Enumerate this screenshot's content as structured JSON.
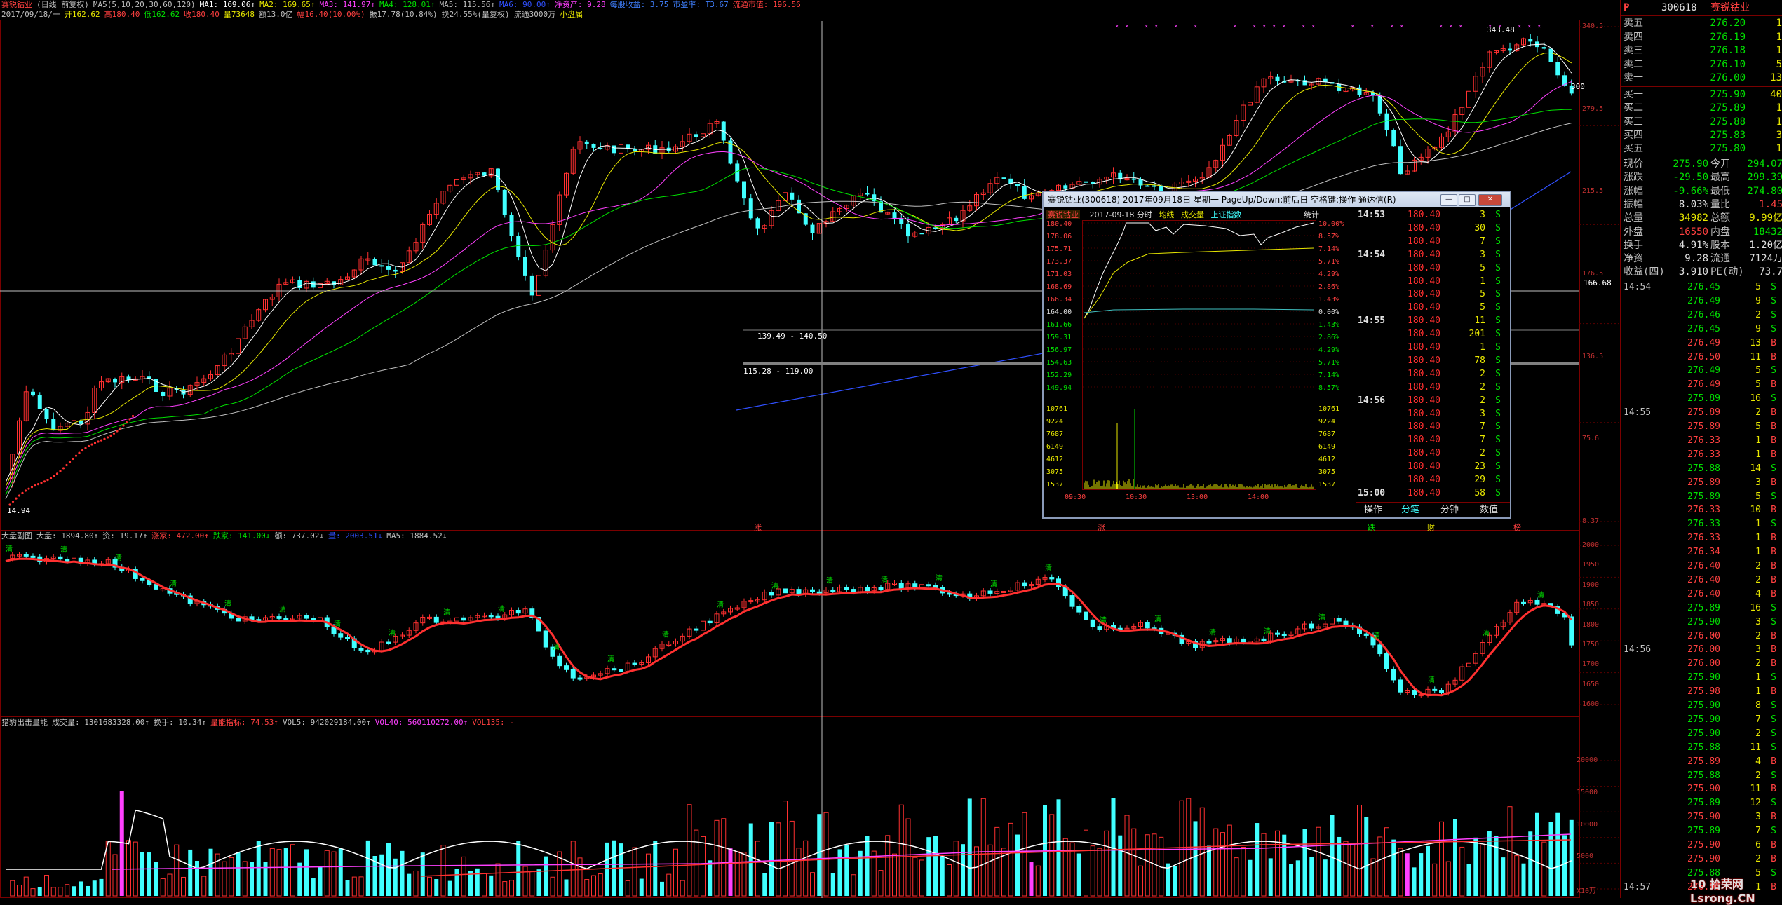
{
  "stock": {
    "name": "赛锐钴业",
    "code": "300618"
  },
  "main_header": {
    "line1": [
      {
        "text": "赛锐钴业",
        "color": "#ff4040"
      },
      {
        "text": "(日线 前复权)",
        "color": "#c0c0c0"
      },
      {
        "text": "MA5(5,10,20,30,60,120)",
        "color": "#c0c0c0"
      },
      {
        "text": "MA1: 169.06↑",
        "color": "#ffffff"
      },
      {
        "text": "MA2: 169.65↑",
        "color": "#e8e800"
      },
      {
        "text": "MA3: 141.97↑",
        "color": "#ff40ff"
      },
      {
        "text": "MA4: 128.01↑",
        "color": "#00e000"
      },
      {
        "text": "MA5: 115.56↑",
        "color": "#c0c0c0"
      },
      {
        "text": "MA6: 90.00↑",
        "color": "#3050ff"
      },
      {
        "text": "净资产: 9.28",
        "color": "#ff40ff"
      },
      {
        "text": "每股收益: 3.75",
        "color": "#4080ff"
      },
      {
        "text": "市盈率: T3.67",
        "color": "#4080ff"
      },
      {
        "text": "流通市值: 196.56",
        "color": "#ff4040"
      }
    ],
    "line2": [
      {
        "text": "2017/09/18/一",
        "color": "#c0c0c0"
      },
      {
        "text": "开162.62",
        "color": "#e8e800"
      },
      {
        "text": "高180.40",
        "color": "#ff4040"
      },
      {
        "text": "低162.62",
        "color": "#00e000"
      },
      {
        "text": "收180.40",
        "color": "#ff4040"
      },
      {
        "text": "量73648",
        "color": "#e8e800"
      },
      {
        "text": "额13.0亿",
        "color": "#c0c0c0"
      },
      {
        "text": "幅16.40(10.00%)",
        "color": "#ff4040"
      },
      {
        "text": "振17.78(10.84%)",
        "color": "#c0c0c0"
      },
      {
        "text": "换24.55%(量复权)",
        "color": "#c0c0c0"
      },
      {
        "text": "流通3000万",
        "color": "#c0c0c0"
      },
      {
        "text": "小盘属",
        "color": "#e8e800"
      }
    ]
  },
  "main_chart": {
    "annotations": [
      "343.48",
      "139.49 - 140.50",
      "115.28 - 119.00",
      "14.94",
      "166.68",
      "300"
    ],
    "right_axis": [
      "340.5",
      "279.5",
      "215.5",
      "176.5",
      "136.5",
      "75.6",
      "8.37"
    ],
    "crosshair_price": "166.68",
    "signal_labels": [
      "涨",
      "涨",
      "跌",
      "财",
      "榜"
    ]
  },
  "market_header": {
    "items": [
      {
        "text": "大盘副图",
        "color": "#c0c0c0"
      },
      {
        "text": "大盘: 1894.80↑",
        "color": "#c0c0c0"
      },
      {
        "text": "资: 19.17↑",
        "color": "#c0c0c0"
      },
      {
        "text": "涨家: 472.00↑",
        "color": "#ff4040"
      },
      {
        "text": "跌家: 141.00↓",
        "color": "#00e000"
      },
      {
        "text": "额: 737.02↓",
        "color": "#c0c0c0"
      },
      {
        "text": "量: 2003.51↓",
        "color": "#3050ff"
      },
      {
        "text": "MA5: 1884.52↓",
        "color": "#c0c0c0"
      }
    ],
    "right_axis": [
      "2000",
      "1950",
      "1900",
      "1850",
      "1800",
      "1750",
      "1700",
      "1650",
      "1600"
    ],
    "marker": "清"
  },
  "volume_header": {
    "items": [
      {
        "text": "猎豹出击量能",
        "color": "#c0c0c0"
      },
      {
        "text": "成交量: 1301683328.00↑",
        "color": "#c0c0c0"
      },
      {
        "text": "换手: 10.34↑",
        "color": "#c0c0c0"
      },
      {
        "text": "量能指标: 74.53↑",
        "color": "#ff4040"
      },
      {
        "text": "VOL5: 942029184.00↑",
        "color": "#c0c0c0"
      },
      {
        "text": "VOL40: 560110272.00↑",
        "color": "#ff40ff"
      },
      {
        "text": "VOL135: -",
        "color": "#ff4040"
      }
    ],
    "right_axis": [
      "20000",
      "15000",
      "10000",
      "5000",
      "X10万"
    ]
  },
  "popup": {
    "title": "赛锐钴业(300618)  2017年09月18日 星期一  PageUp/Down:前后日  空格键:操作  通达信(R)",
    "sub_header": [
      "赛锐钴业",
      "2017-09-18 分时",
      "均线",
      "成交量",
      "上证指数",
      "统计"
    ],
    "price_axis_left": [
      "180.40",
      "178.06",
      "175.71",
      "173.37",
      "171.03",
      "168.69",
      "166.34",
      "164.00",
      "161.66",
      "159.31",
      "156.97",
      "154.63",
      "152.29",
      "149.94"
    ],
    "pct_axis_right": [
      "10.00%",
      "8.57%",
      "7.14%",
      "5.71%",
      "4.29%",
      "2.86%",
      "1.43%",
      "0.00%",
      "1.43%",
      "2.86%",
      "4.29%",
      "5.71%",
      "7.14%",
      "8.57%"
    ],
    "vol_axis_left": [
      "10761",
      "9224",
      "7687",
      "6149",
      "4612",
      "3075",
      "1537"
    ],
    "vol_axis_right": [
      "10761",
      "9224",
      "7687",
      "6149",
      "4612",
      "3075",
      "1537"
    ],
    "time_axis": [
      "09:30",
      "10:30",
      "13:00",
      "14:00"
    ],
    "ticks": [
      {
        "time": "14:53",
        "price": "180.40",
        "vol": "3",
        "side": "S"
      },
      {
        "time": "",
        "price": "180.40",
        "vol": "30",
        "side": "S"
      },
      {
        "time": "",
        "price": "180.40",
        "vol": "7",
        "side": "S"
      },
      {
        "time": "14:54",
        "price": "180.40",
        "vol": "3",
        "side": "S"
      },
      {
        "time": "",
        "price": "180.40",
        "vol": "5",
        "side": "S"
      },
      {
        "time": "",
        "price": "180.40",
        "vol": "1",
        "side": "S"
      },
      {
        "time": "",
        "price": "180.40",
        "vol": "5",
        "side": "S"
      },
      {
        "time": "",
        "price": "180.40",
        "vol": "5",
        "side": "S"
      },
      {
        "time": "14:55",
        "price": "180.40",
        "vol": "11",
        "side": "S"
      },
      {
        "time": "",
        "price": "180.40",
        "vol": "201",
        "side": "S"
      },
      {
        "time": "",
        "price": "180.40",
        "vol": "1",
        "side": "S"
      },
      {
        "time": "",
        "price": "180.40",
        "vol": "78",
        "side": "S"
      },
      {
        "time": "",
        "price": "180.40",
        "vol": "2",
        "side": "S"
      },
      {
        "time": "",
        "price": "180.40",
        "vol": "2",
        "side": "S"
      },
      {
        "time": "14:56",
        "price": "180.40",
        "vol": "2",
        "side": "S"
      },
      {
        "time": "",
        "price": "180.40",
        "vol": "3",
        "side": "S"
      },
      {
        "time": "",
        "price": "180.40",
        "vol": "7",
        "side": "S"
      },
      {
        "time": "",
        "price": "180.40",
        "vol": "7",
        "side": "S"
      },
      {
        "time": "",
        "price": "180.40",
        "vol": "2",
        "side": "S"
      },
      {
        "time": "",
        "price": "180.40",
        "vol": "23",
        "side": "S"
      },
      {
        "time": "",
        "price": "180.40",
        "vol": "29",
        "side": "S"
      },
      {
        "time": "15:00",
        "price": "180.40",
        "vol": "58",
        "side": "S"
      }
    ],
    "tabs": [
      "操作",
      "分笔",
      "分钟",
      "数值"
    ]
  },
  "quote": {
    "header_letter": "P",
    "asks": [
      {
        "label": "卖五",
        "price": "276.20",
        "vol": "1"
      },
      {
        "label": "卖四",
        "price": "276.19",
        "vol": "1"
      },
      {
        "label": "卖三",
        "price": "276.18",
        "vol": "1"
      },
      {
        "label": "卖二",
        "price": "276.10",
        "vol": "5"
      },
      {
        "label": "卖一",
        "price": "276.00",
        "vol": "13"
      }
    ],
    "bids": [
      {
        "label": "买一",
        "price": "275.90",
        "vol": "40"
      },
      {
        "label": "买二",
        "price": "275.89",
        "vol": "1"
      },
      {
        "label": "买三",
        "price": "275.88",
        "vol": "1"
      },
      {
        "label": "买四",
        "price": "275.83",
        "vol": "3"
      },
      {
        "label": "买五",
        "price": "275.80",
        "vol": "1"
      }
    ],
    "stats": [
      {
        "l1": "现价",
        "v1": "275.90",
        "c1": "#00e000",
        "l2": "今开",
        "v2": "294.07",
        "c2": "#00e000"
      },
      {
        "l1": "涨跌",
        "v1": "-29.50",
        "c1": "#00e000",
        "l2": "最高",
        "v2": "299.39",
        "c2": "#00e000"
      },
      {
        "l1": "涨幅",
        "v1": "-9.66%",
        "c1": "#00e000",
        "l2": "最低",
        "v2": "274.80",
        "c2": "#00e000"
      },
      {
        "l1": "振幅",
        "v1": "8.03%",
        "c1": "#e0e0e0",
        "l2": "量比",
        "v2": "1.45",
        "c2": "#ff4040"
      },
      {
        "l1": "总量",
        "v1": "34982",
        "c1": "#e8e800",
        "l2": "总额",
        "v2": "9.99亿",
        "c2": "#e8e800"
      },
      {
        "l1": "外盘",
        "v1": "16550",
        "c1": "#ff4040",
        "l2": "内盘",
        "v2": "18432",
        "c2": "#00e000"
      },
      {
        "l1": "换手",
        "v1": "4.91%",
        "c1": "#e0e0e0",
        "l2": "股本",
        "v2": "1.20亿",
        "c2": "#e0e0e0"
      },
      {
        "l1": "净资",
        "v1": "9.28",
        "c1": "#e0e0e0",
        "l2": "流通",
        "v2": "7124万",
        "c2": "#e0e0e0"
      },
      {
        "l1": "收益(四)",
        "v1": "3.910",
        "c1": "#e0e0e0",
        "l2": "PE(动)",
        "v2": "73.7",
        "c2": "#e0e0e0"
      }
    ],
    "ticks": [
      {
        "time": "14:54",
        "price": "276.45",
        "vol": "5",
        "side": "S",
        "c": "#00e000"
      },
      {
        "time": "",
        "price": "276.49",
        "vol": "9",
        "side": "S",
        "c": "#00e000"
      },
      {
        "time": "",
        "price": "276.46",
        "vol": "2",
        "side": "S",
        "c": "#00e000"
      },
      {
        "time": "",
        "price": "276.45",
        "vol": "9",
        "side": "S",
        "c": "#00e000"
      },
      {
        "time": "",
        "price": "276.49",
        "vol": "13",
        "side": "B",
        "c": "#ff4040"
      },
      {
        "time": "",
        "price": "276.50",
        "vol": "11",
        "side": "B",
        "c": "#ff4040"
      },
      {
        "time": "",
        "price": "276.49",
        "vol": "5",
        "side": "S",
        "c": "#00e000"
      },
      {
        "time": "",
        "price": "276.49",
        "vol": "5",
        "side": "B",
        "c": "#ff4040"
      },
      {
        "time": "",
        "price": "275.89",
        "vol": "16",
        "side": "S",
        "c": "#00e000"
      },
      {
        "time": "14:55",
        "price": "275.89",
        "vol": "2",
        "side": "B",
        "c": "#ff4040"
      },
      {
        "time": "",
        "price": "275.89",
        "vol": "5",
        "side": "B",
        "c": "#ff4040"
      },
      {
        "time": "",
        "price": "276.33",
        "vol": "1",
        "side": "B",
        "c": "#ff4040"
      },
      {
        "time": "",
        "price": "276.33",
        "vol": "1",
        "side": "B",
        "c": "#ff4040"
      },
      {
        "time": "",
        "price": "275.88",
        "vol": "14",
        "side": "S",
        "c": "#00e000"
      },
      {
        "time": "",
        "price": "275.89",
        "vol": "3",
        "side": "B",
        "c": "#ff4040"
      },
      {
        "time": "",
        "price": "275.89",
        "vol": "5",
        "side": "S",
        "c": "#00e000"
      },
      {
        "time": "",
        "price": "276.33",
        "vol": "10",
        "side": "B",
        "c": "#ff4040"
      },
      {
        "time": "",
        "price": "276.33",
        "vol": "1",
        "side": "S",
        "c": "#00e000"
      },
      {
        "time": "",
        "price": "276.33",
        "vol": "1",
        "side": "B",
        "c": "#ff4040"
      },
      {
        "time": "",
        "price": "276.34",
        "vol": "1",
        "side": "B",
        "c": "#ff4040"
      },
      {
        "time": "",
        "price": "276.40",
        "vol": "2",
        "side": "B",
        "c": "#ff4040"
      },
      {
        "time": "",
        "price": "276.40",
        "vol": "2",
        "side": "B",
        "c": "#ff4040"
      },
      {
        "time": "",
        "price": "276.40",
        "vol": "4",
        "side": "B",
        "c": "#ff4040"
      },
      {
        "time": "",
        "price": "275.89",
        "vol": "16",
        "side": "S",
        "c": "#00e000"
      },
      {
        "time": "",
        "price": "275.90",
        "vol": "3",
        "side": "S",
        "c": "#00e000"
      },
      {
        "time": "",
        "price": "276.00",
        "vol": "2",
        "side": "B",
        "c": "#ff4040"
      },
      {
        "time": "14:56",
        "price": "276.00",
        "vol": "3",
        "side": "B",
        "c": "#ff4040"
      },
      {
        "time": "",
        "price": "276.00",
        "vol": "2",
        "side": "B",
        "c": "#ff4040"
      },
      {
        "time": "",
        "price": "275.90",
        "vol": "1",
        "side": "S",
        "c": "#00e000"
      },
      {
        "time": "",
        "price": "275.98",
        "vol": "1",
        "side": "B",
        "c": "#ff4040"
      },
      {
        "time": "",
        "price": "275.90",
        "vol": "8",
        "side": "S",
        "c": "#00e000"
      },
      {
        "time": "",
        "price": "275.90",
        "vol": "7",
        "side": "S",
        "c": "#00e000"
      },
      {
        "time": "",
        "price": "275.90",
        "vol": "2",
        "side": "S",
        "c": "#00e000"
      },
      {
        "time": "",
        "price": "275.88",
        "vol": "11",
        "side": "S",
        "c": "#00e000"
      },
      {
        "time": "",
        "price": "275.89",
        "vol": "4",
        "side": "B",
        "c": "#ff4040"
      },
      {
        "time": "",
        "price": "275.88",
        "vol": "2",
        "side": "S",
        "c": "#00e000"
      },
      {
        "time": "",
        "price": "275.90",
        "vol": "11",
        "side": "B",
        "c": "#ff4040"
      },
      {
        "time": "",
        "price": "275.89",
        "vol": "12",
        "side": "S",
        "c": "#00e000"
      },
      {
        "time": "",
        "price": "275.90",
        "vol": "3",
        "side": "B",
        "c": "#ff4040"
      },
      {
        "time": "",
        "price": "275.89",
        "vol": "7",
        "side": "S",
        "c": "#00e000"
      },
      {
        "time": "",
        "price": "275.90",
        "vol": "6",
        "side": "B",
        "c": "#ff4040"
      },
      {
        "time": "",
        "price": "275.90",
        "vol": "2",
        "side": "B",
        "c": "#ff4040"
      },
      {
        "time": "",
        "price": "275.88",
        "vol": "5",
        "side": "S",
        "c": "#00e000"
      },
      {
        "time": "14:57",
        "price": "276.00",
        "vol": "1",
        "side": "B",
        "c": "#ff4040"
      }
    ]
  },
  "watermark": "10 拾荣网 Lsrong.CN"
}
